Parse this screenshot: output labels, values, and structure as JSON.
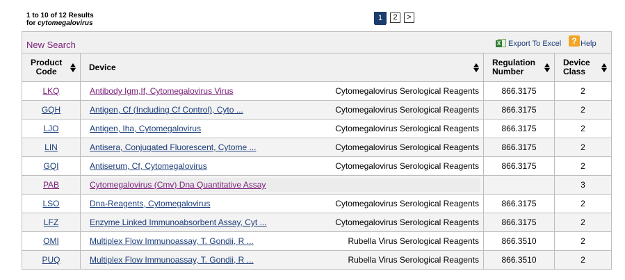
{
  "summary": {
    "range": "1 to 10 of 12 Results",
    "for_label": "for ",
    "term": "cytomegalovirus"
  },
  "pager": {
    "pages": [
      "1",
      "2"
    ],
    "current": "1",
    "next": ">"
  },
  "toolbar": {
    "new_search": "New Search",
    "export": "Export To Excel",
    "help": "Help",
    "excel_icon": "excel-icon",
    "help_icon": "help-icon"
  },
  "columns": {
    "product_code": [
      "Product",
      "Code"
    ],
    "device": "Device",
    "regulation_number": [
      "Regulation",
      "Number"
    ],
    "device_class": [
      "Device",
      "Class"
    ]
  },
  "rows": [
    {
      "code": "LKQ",
      "device": "Antibody Igm,If, Cytomegalovirus Virus",
      "panel": "Cytomegalovirus Serological Reagents",
      "regulation": "866.3175",
      "class": "2",
      "visited": true
    },
    {
      "code": "GQH",
      "device": "Antigen, Cf (Including Cf Control), Cyto ...",
      "panel": "Cytomegalovirus Serological Reagents",
      "regulation": "866.3175",
      "class": "2",
      "visited": false
    },
    {
      "code": "LJO",
      "device": "Antigen, Iha, Cytomegalovirus",
      "panel": "Cytomegalovirus Serological Reagents",
      "regulation": "866.3175",
      "class": "2",
      "visited": false
    },
    {
      "code": "LIN",
      "device": "Antisera, Conjugated Fluorescent, Cytome ...",
      "panel": "Cytomegalovirus Serological Reagents",
      "regulation": "866.3175",
      "class": "2",
      "visited": false
    },
    {
      "code": "GQI",
      "device": "Antiserum, Cf, Cytomegalovirus",
      "panel": "Cytomegalovirus Serological Reagents",
      "regulation": "866.3175",
      "class": "2",
      "visited": false
    },
    {
      "code": "PAB",
      "device": "Cytomegalovirus (Cmv) Dna Quantitative Assay",
      "panel": "",
      "regulation": "",
      "class": "3",
      "visited": true
    },
    {
      "code": "LSO",
      "device": "Dna-Reagents, Cytomegalovirus",
      "panel": "Cytomegalovirus Serological Reagents",
      "regulation": "866.3175",
      "class": "2",
      "visited": false
    },
    {
      "code": "LFZ",
      "device": "Enzyme Linked Immunoabsorbent Assay, Cyt ...",
      "panel": "Cytomegalovirus Serological Reagents",
      "regulation": "866.3175",
      "class": "2",
      "visited": false
    },
    {
      "code": "OMI",
      "device": "Multiplex Flow Immunoassay, T. Gondii, R ...",
      "panel": "Rubella Virus Serological Reagents",
      "regulation": "866.3510",
      "class": "2",
      "visited": false
    },
    {
      "code": "PUQ",
      "device": "Multiplex Flow Immunoassay, T. Gondii, R ...",
      "panel": "Rubella Virus Serological Reagents",
      "regulation": "866.3510",
      "class": "2",
      "visited": false
    }
  ]
}
